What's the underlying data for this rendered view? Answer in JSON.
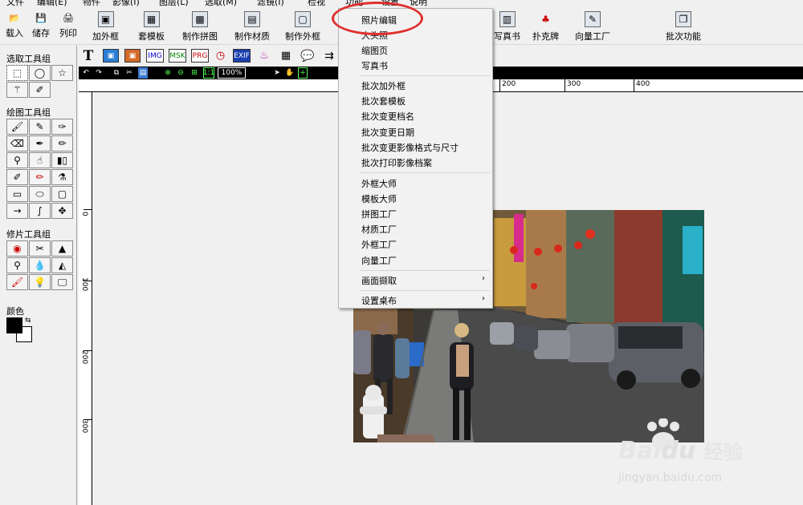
{
  "menubar": {
    "items": [
      "文件",
      "编辑(E)",
      "物件",
      "影像(I)",
      "图层(L)",
      "选取(M)",
      "滤镜(I)",
      "检视",
      "功能",
      "设置",
      "说明"
    ]
  },
  "toolbar": {
    "buttons": [
      "载入",
      "储存",
      "列印",
      "加外框",
      "套模板",
      "制作拼图",
      "制作材质",
      "制作外框",
      "写真书",
      "扑克牌",
      "向量工厂",
      "批次功能"
    ]
  },
  "left_panel": {
    "select_group": "选取工具组",
    "draw_group": "绘图工具组",
    "retouch_group": "修片工具组",
    "color_label": "颜色"
  },
  "tools2": {
    "exif": "EXIF",
    "img": "IMG",
    "msk": "MSK",
    "prg": "PRG"
  },
  "zoom": {
    "label": "1:1",
    "value": "100%"
  },
  "ruler": {
    "h_labels": [
      "200",
      "300",
      "400"
    ],
    "v_labels": [
      "0",
      "100",
      "200",
      "300"
    ]
  },
  "dropdown": {
    "items": [
      "照片编辑",
      "大头照",
      "缩图页",
      "写真书",
      "批次加外框",
      "批次套模板",
      "批次变更档名",
      "批次变更日期",
      "批次变更影像格式与尺寸",
      "批次打印影像档案",
      "外框大师",
      "模板大师",
      "拼图工厂",
      "材质工厂",
      "外框工厂",
      "向量工厂",
      "画面撷取",
      "设置桌布"
    ]
  },
  "watermark": {
    "brand": "Bai",
    "brand2": "du",
    "brand_cn": "经验",
    "url": "jingyan.baidu.com"
  },
  "colors": {
    "highlight": "#e0302e",
    "fg": "#000000",
    "bg": "#ffffff"
  }
}
